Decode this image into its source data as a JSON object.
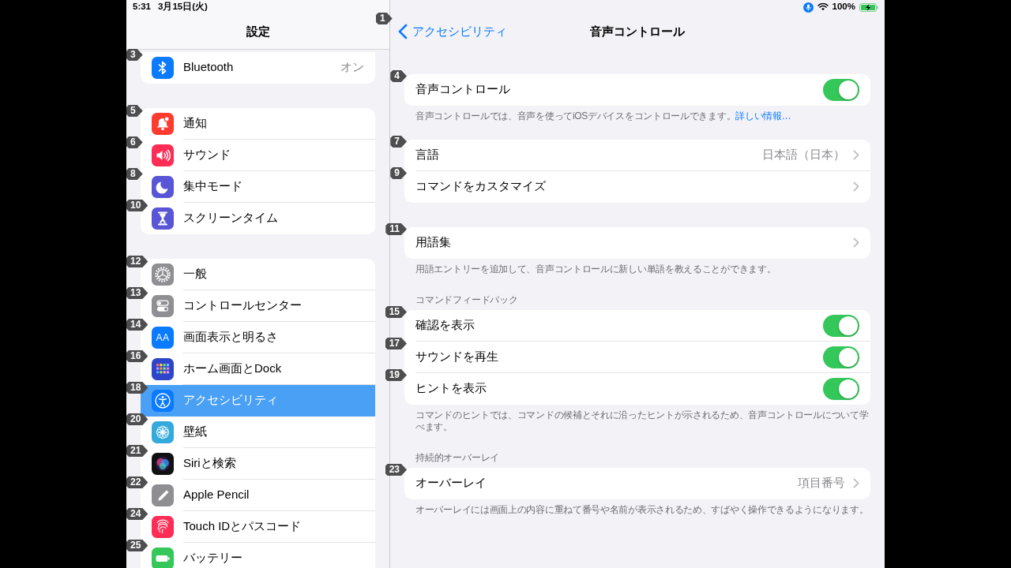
{
  "status_bar": {
    "time": "5:31",
    "date": "3月15日(火)",
    "battery_reading": "100%",
    "charging": true
  },
  "sidebar": {
    "title": "設定",
    "groups": [
      {
        "items": [
          {
            "label": "Bluetooth",
            "value": "オン",
            "badge": "3",
            "selected": false
          }
        ]
      },
      {
        "items": [
          {
            "label": "通知",
            "badge": "5",
            "selected": false
          },
          {
            "label": "サウンド",
            "badge": "6",
            "selected": false
          },
          {
            "label": "集中モード",
            "badge": "8",
            "selected": false
          },
          {
            "label": "スクリーンタイム",
            "badge": "10",
            "selected": false
          }
        ]
      },
      {
        "items": [
          {
            "label": "一般",
            "badge": "12",
            "selected": false
          },
          {
            "label": "コントロールセンター",
            "badge": "13",
            "selected": false
          },
          {
            "label": "画面表示と明るさ",
            "icon_text": "AA",
            "badge": "14",
            "selected": false
          },
          {
            "label": "ホーム画面とDock",
            "badge": "16",
            "selected": false
          },
          {
            "label": "アクセシビリティ",
            "badge": "18",
            "selected": true
          },
          {
            "label": "壁紙",
            "badge": "20",
            "selected": false
          },
          {
            "label": "Siriと検索",
            "badge": "21",
            "selected": false
          },
          {
            "label": "Apple Pencil",
            "badge": "22",
            "selected": false
          },
          {
            "label": "Touch IDとパスコード",
            "badge": "24",
            "selected": false
          },
          {
            "label": "バッテリー",
            "badge": "25",
            "selected": false
          }
        ]
      }
    ]
  },
  "detail": {
    "back": {
      "label": "アクセシビリティ",
      "badge": "1"
    },
    "title": "音声コントロール",
    "sections": [
      {
        "rows": [
          {
            "kind": "toggle",
            "label": "音声コントロール",
            "badge": "4",
            "on": true
          }
        ],
        "footer": "音声コントロールでは、音声を使ってiOSデバイスをコントロールできます。",
        "footer_link": "詳しい情報…"
      },
      {
        "rows": [
          {
            "kind": "link",
            "label": "言語",
            "value": "日本語（日本）",
            "badge": "7"
          },
          {
            "kind": "link",
            "label": "コマンドをカスタマイズ",
            "badge": "9"
          }
        ]
      },
      {
        "rows": [
          {
            "kind": "link",
            "label": "用語集",
            "badge": "11"
          }
        ],
        "footer": "用語エントリーを追加して、音声コントロールに新しい単語を教えることができます。"
      },
      {
        "header": "コマンドフィードバック",
        "rows": [
          {
            "kind": "toggle",
            "label": "確認を表示",
            "badge": "15",
            "on": true
          },
          {
            "kind": "toggle",
            "label": "サウンドを再生",
            "badge": "17",
            "on": true
          },
          {
            "kind": "toggle",
            "label": "ヒントを表示",
            "badge": "19",
            "on": true
          }
        ],
        "footer": "コマンドのヒントでは、コマンドの候補とそれに沿ったヒントが示されるため、音声コントロールについて学べます。"
      },
      {
        "header": "持続的オーバーレイ",
        "rows": [
          {
            "kind": "link",
            "label": "オーバーレイ",
            "value": "項目番号",
            "badge": "23"
          }
        ],
        "footer": "オーバーレイには画面上の内容に重ねて番号や名前が表示されるため、すばやく操作できるようになります。"
      }
    ]
  }
}
